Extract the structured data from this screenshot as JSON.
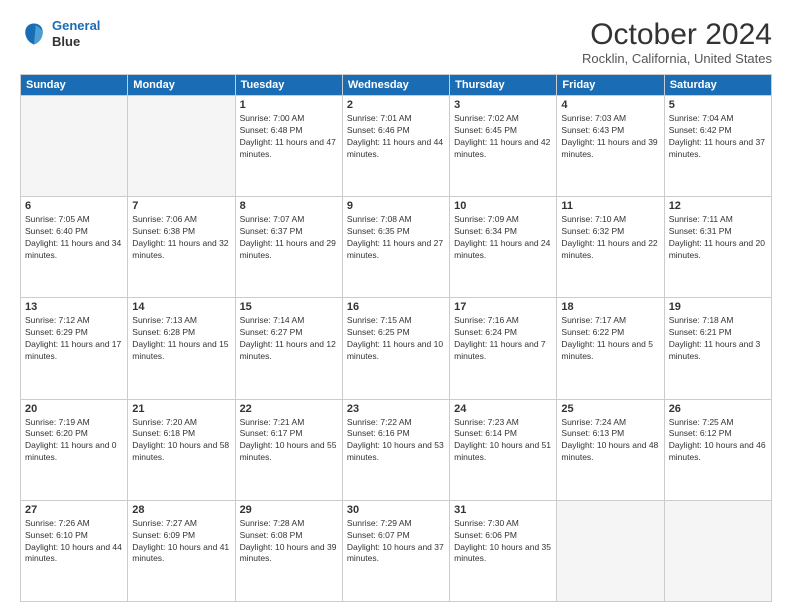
{
  "header": {
    "logo_line1": "General",
    "logo_line2": "Blue",
    "title": "October 2024",
    "subtitle": "Rocklin, California, United States"
  },
  "weekdays": [
    "Sunday",
    "Monday",
    "Tuesday",
    "Wednesday",
    "Thursday",
    "Friday",
    "Saturday"
  ],
  "weeks": [
    [
      {
        "day": "",
        "info": ""
      },
      {
        "day": "",
        "info": ""
      },
      {
        "day": "1",
        "info": "Sunrise: 7:00 AM\nSunset: 6:48 PM\nDaylight: 11 hours and 47 minutes."
      },
      {
        "day": "2",
        "info": "Sunrise: 7:01 AM\nSunset: 6:46 PM\nDaylight: 11 hours and 44 minutes."
      },
      {
        "day": "3",
        "info": "Sunrise: 7:02 AM\nSunset: 6:45 PM\nDaylight: 11 hours and 42 minutes."
      },
      {
        "day": "4",
        "info": "Sunrise: 7:03 AM\nSunset: 6:43 PM\nDaylight: 11 hours and 39 minutes."
      },
      {
        "day": "5",
        "info": "Sunrise: 7:04 AM\nSunset: 6:42 PM\nDaylight: 11 hours and 37 minutes."
      }
    ],
    [
      {
        "day": "6",
        "info": "Sunrise: 7:05 AM\nSunset: 6:40 PM\nDaylight: 11 hours and 34 minutes."
      },
      {
        "day": "7",
        "info": "Sunrise: 7:06 AM\nSunset: 6:38 PM\nDaylight: 11 hours and 32 minutes."
      },
      {
        "day": "8",
        "info": "Sunrise: 7:07 AM\nSunset: 6:37 PM\nDaylight: 11 hours and 29 minutes."
      },
      {
        "day": "9",
        "info": "Sunrise: 7:08 AM\nSunset: 6:35 PM\nDaylight: 11 hours and 27 minutes."
      },
      {
        "day": "10",
        "info": "Sunrise: 7:09 AM\nSunset: 6:34 PM\nDaylight: 11 hours and 24 minutes."
      },
      {
        "day": "11",
        "info": "Sunrise: 7:10 AM\nSunset: 6:32 PM\nDaylight: 11 hours and 22 minutes."
      },
      {
        "day": "12",
        "info": "Sunrise: 7:11 AM\nSunset: 6:31 PM\nDaylight: 11 hours and 20 minutes."
      }
    ],
    [
      {
        "day": "13",
        "info": "Sunrise: 7:12 AM\nSunset: 6:29 PM\nDaylight: 11 hours and 17 minutes."
      },
      {
        "day": "14",
        "info": "Sunrise: 7:13 AM\nSunset: 6:28 PM\nDaylight: 11 hours and 15 minutes."
      },
      {
        "day": "15",
        "info": "Sunrise: 7:14 AM\nSunset: 6:27 PM\nDaylight: 11 hours and 12 minutes."
      },
      {
        "day": "16",
        "info": "Sunrise: 7:15 AM\nSunset: 6:25 PM\nDaylight: 11 hours and 10 minutes."
      },
      {
        "day": "17",
        "info": "Sunrise: 7:16 AM\nSunset: 6:24 PM\nDaylight: 11 hours and 7 minutes."
      },
      {
        "day": "18",
        "info": "Sunrise: 7:17 AM\nSunset: 6:22 PM\nDaylight: 11 hours and 5 minutes."
      },
      {
        "day": "19",
        "info": "Sunrise: 7:18 AM\nSunset: 6:21 PM\nDaylight: 11 hours and 3 minutes."
      }
    ],
    [
      {
        "day": "20",
        "info": "Sunrise: 7:19 AM\nSunset: 6:20 PM\nDaylight: 11 hours and 0 minutes."
      },
      {
        "day": "21",
        "info": "Sunrise: 7:20 AM\nSunset: 6:18 PM\nDaylight: 10 hours and 58 minutes."
      },
      {
        "day": "22",
        "info": "Sunrise: 7:21 AM\nSunset: 6:17 PM\nDaylight: 10 hours and 55 minutes."
      },
      {
        "day": "23",
        "info": "Sunrise: 7:22 AM\nSunset: 6:16 PM\nDaylight: 10 hours and 53 minutes."
      },
      {
        "day": "24",
        "info": "Sunrise: 7:23 AM\nSunset: 6:14 PM\nDaylight: 10 hours and 51 minutes."
      },
      {
        "day": "25",
        "info": "Sunrise: 7:24 AM\nSunset: 6:13 PM\nDaylight: 10 hours and 48 minutes."
      },
      {
        "day": "26",
        "info": "Sunrise: 7:25 AM\nSunset: 6:12 PM\nDaylight: 10 hours and 46 minutes."
      }
    ],
    [
      {
        "day": "27",
        "info": "Sunrise: 7:26 AM\nSunset: 6:10 PM\nDaylight: 10 hours and 44 minutes."
      },
      {
        "day": "28",
        "info": "Sunrise: 7:27 AM\nSunset: 6:09 PM\nDaylight: 10 hours and 41 minutes."
      },
      {
        "day": "29",
        "info": "Sunrise: 7:28 AM\nSunset: 6:08 PM\nDaylight: 10 hours and 39 minutes."
      },
      {
        "day": "30",
        "info": "Sunrise: 7:29 AM\nSunset: 6:07 PM\nDaylight: 10 hours and 37 minutes."
      },
      {
        "day": "31",
        "info": "Sunrise: 7:30 AM\nSunset: 6:06 PM\nDaylight: 10 hours and 35 minutes."
      },
      {
        "day": "",
        "info": ""
      },
      {
        "day": "",
        "info": ""
      }
    ]
  ]
}
